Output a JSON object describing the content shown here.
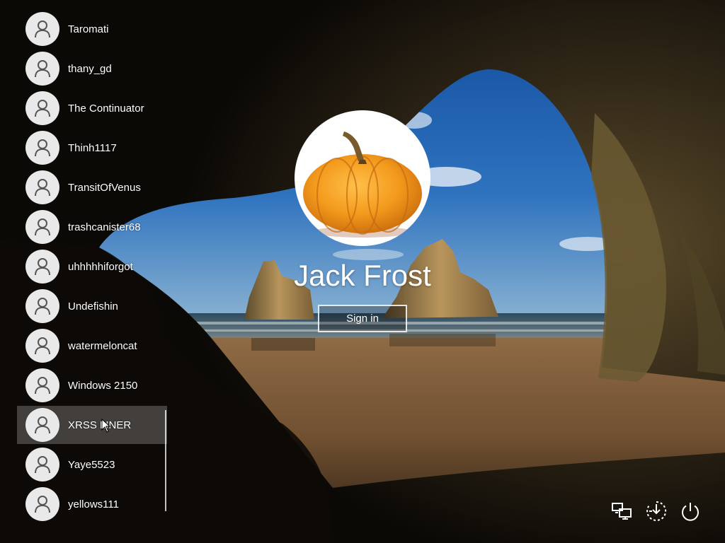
{
  "login": {
    "display_name": "Jack Frost",
    "sign_in_label": "Sign in"
  },
  "users": [
    {
      "name": "Taromati"
    },
    {
      "name": "thany_gd"
    },
    {
      "name": "The Continuator"
    },
    {
      "name": "Thinh1117"
    },
    {
      "name": "TransitOfVenus"
    },
    {
      "name": "trashcanister68"
    },
    {
      "name": "uhhhhhiforgot"
    },
    {
      "name": "Undefishin"
    },
    {
      "name": "watermeloncat"
    },
    {
      "name": "Windows 2150"
    },
    {
      "name": "XRSS LINER"
    },
    {
      "name": "Yaye5523"
    },
    {
      "name": "yellows111"
    }
  ],
  "hovered_user": "XRSS LINER",
  "system_icons": [
    "network-icon",
    "accessibility-icon",
    "power-icon"
  ],
  "colors": {
    "avatar_bg": "#e9e9e9",
    "avatar_glyph": "#555555",
    "pumpkin": "#f39a1c",
    "sky": "#1f5fae"
  }
}
